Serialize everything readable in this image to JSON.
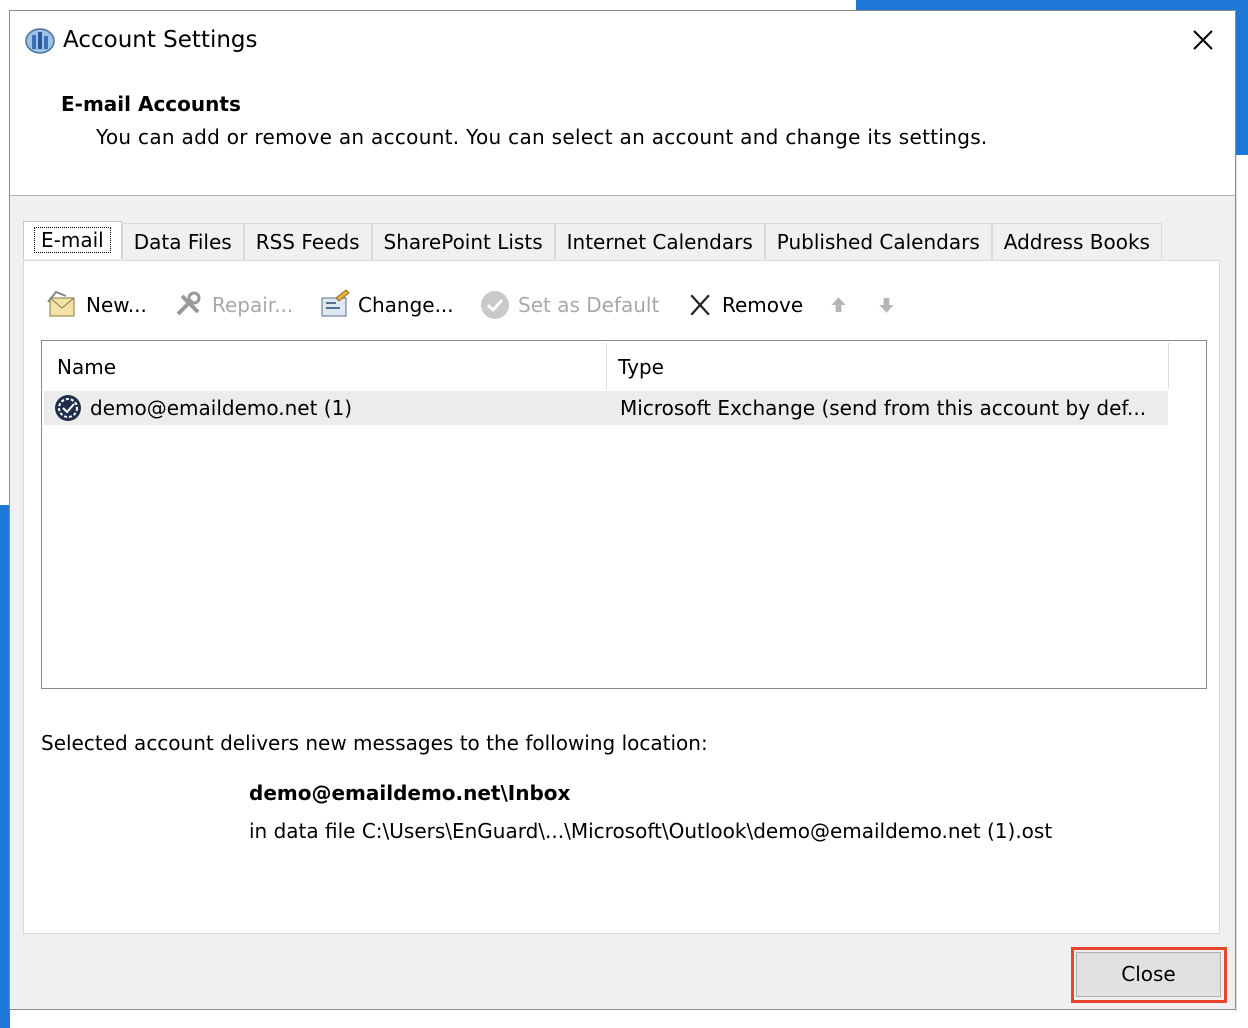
{
  "window": {
    "title": "Account Settings",
    "close_label": "Close window"
  },
  "header": {
    "heading": "E-mail Accounts",
    "description": "You can add or remove an account. You can select an account and change its settings."
  },
  "tabs": [
    {
      "label": "E-mail",
      "active": true
    },
    {
      "label": "Data Files",
      "active": false
    },
    {
      "label": "RSS Feeds",
      "active": false
    },
    {
      "label": "SharePoint Lists",
      "active": false
    },
    {
      "label": "Internet Calendars",
      "active": false
    },
    {
      "label": "Published Calendars",
      "active": false
    },
    {
      "label": "Address Books",
      "active": false
    }
  ],
  "toolbar": {
    "new_label": "New...",
    "repair_label": "Repair...",
    "change_label": "Change...",
    "set_default_label": "Set as Default",
    "remove_label": "Remove",
    "move_up_icon": "arrow-up-icon",
    "move_down_icon": "arrow-down-icon"
  },
  "accounts_table": {
    "columns": [
      "Name",
      "Type"
    ],
    "rows": [
      {
        "name": "demo@emaildemo.net (1)",
        "type": "Microsoft Exchange (send from this account by def...",
        "selected": true
      }
    ]
  },
  "delivery": {
    "label": "Selected account delivers new messages to the following location:",
    "folder": "demo@emaildemo.net\\Inbox",
    "data_file": "in data file C:\\Users\\EnGuard\\...\\Microsoft\\Outlook\\demo@emaildemo.net (1).ost"
  },
  "footer": {
    "close_label": "Close"
  },
  "colors": {
    "highlight": "#e8442e",
    "desktop_blue": "#1e78d7"
  }
}
